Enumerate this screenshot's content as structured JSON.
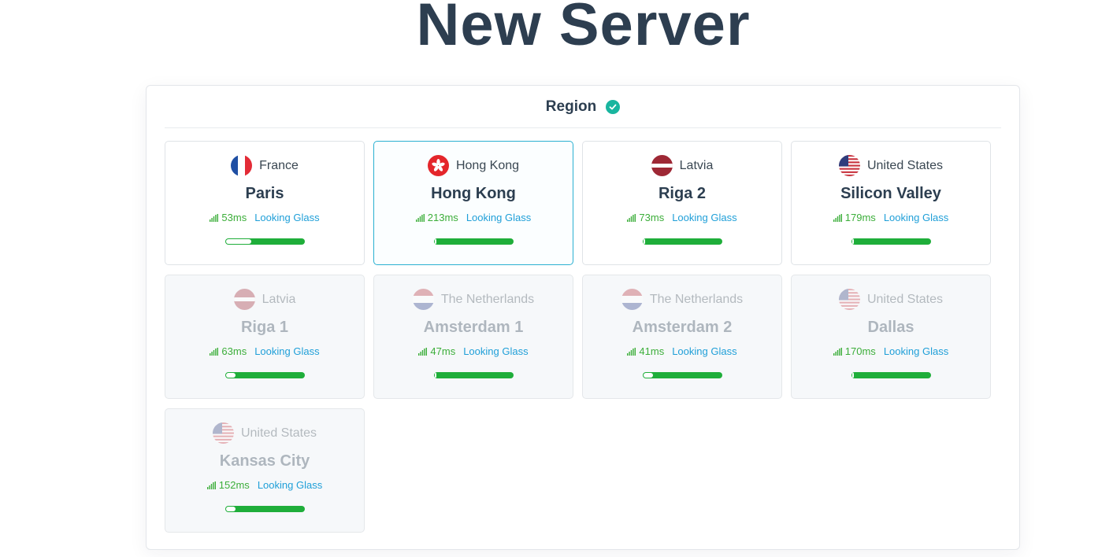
{
  "page": {
    "title": "New Server"
  },
  "region": {
    "title": "Region",
    "colors": {
      "check": "#19b59f",
      "selected_border": "#2ab0d1",
      "ping": "#3cae3a",
      "link": "#1f9fd8",
      "bar": "#1fae3a"
    },
    "locations": [
      {
        "country": "France",
        "flag": "france-flag-icon",
        "city": "Paris",
        "ping": "53ms",
        "link": "Looking Glass",
        "load": 0.32,
        "state": "available"
      },
      {
        "country": "Hong Kong",
        "flag": "hong-kong-flag-icon",
        "city": "Hong Kong",
        "ping": "213ms",
        "link": "Looking Glass",
        "load": 0.02,
        "state": "selected"
      },
      {
        "country": "Latvia",
        "flag": "latvia-flag-icon",
        "city": "Riga 2",
        "ping": "73ms",
        "link": "Looking Glass",
        "load": 0.02,
        "state": "available"
      },
      {
        "country": "United States",
        "flag": "us-flag-icon",
        "city": "Silicon Valley",
        "ping": "179ms",
        "link": "Looking Glass",
        "load": 0.02,
        "state": "available"
      },
      {
        "country": "Latvia",
        "flag": "latvia-flag-icon",
        "city": "Riga 1",
        "ping": "63ms",
        "link": "Looking Glass",
        "load": 0.12,
        "state": "disabled"
      },
      {
        "country": "The Netherlands",
        "flag": "netherlands-flag-icon",
        "city": "Amsterdam 1",
        "ping": "47ms",
        "link": "Looking Glass",
        "load": 0.02,
        "state": "disabled"
      },
      {
        "country": "The Netherlands",
        "flag": "netherlands-flag-icon",
        "city": "Amsterdam 2",
        "ping": "41ms",
        "link": "Looking Glass",
        "load": 0.12,
        "state": "disabled"
      },
      {
        "country": "United States",
        "flag": "us-flag-icon",
        "city": "Dallas",
        "ping": "170ms",
        "link": "Looking Glass",
        "load": 0.02,
        "state": "disabled"
      },
      {
        "country": "United States",
        "flag": "us-flag-icon",
        "city": "Kansas City",
        "ping": "152ms",
        "link": "Looking Glass",
        "load": 0.12,
        "state": "disabled"
      }
    ]
  }
}
